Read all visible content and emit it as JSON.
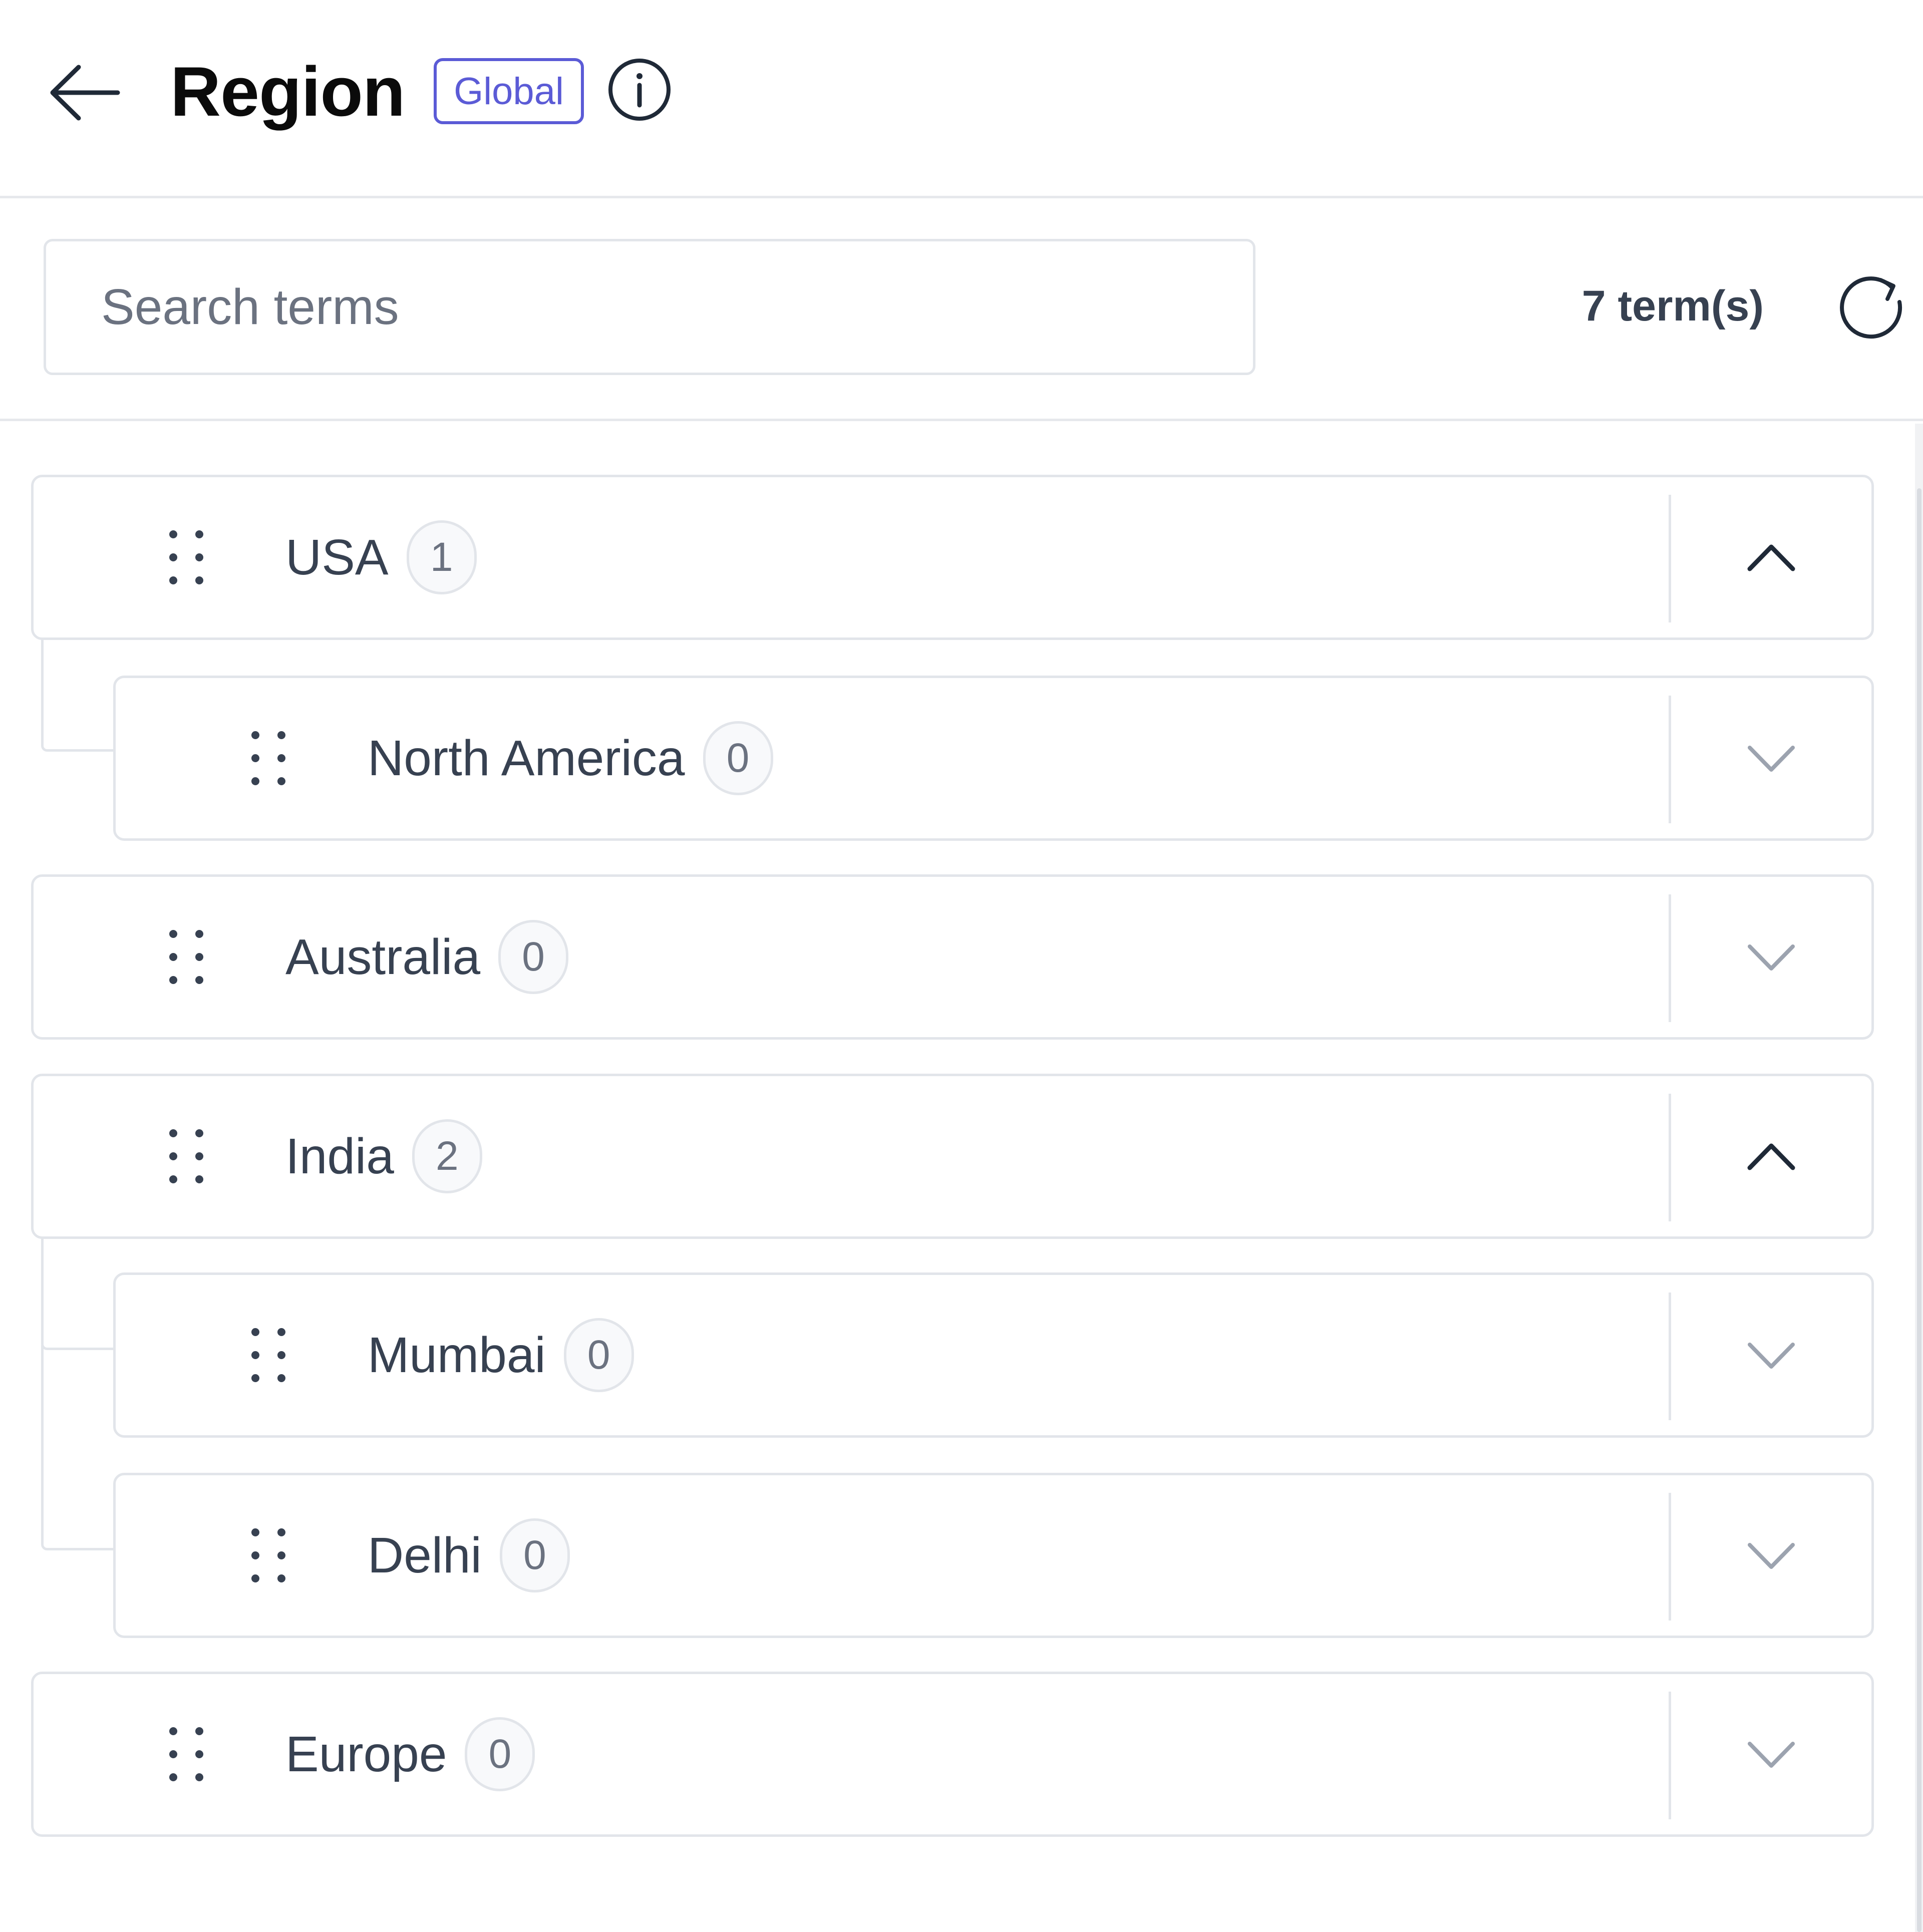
{
  "header": {
    "title": "Region",
    "scope_badge": "Global",
    "back_icon": "arrow-left-icon",
    "info_icon": "info-circle-icon"
  },
  "toolbar": {
    "search_placeholder": "Search terms",
    "search_value": "",
    "term_count": "7 term(s)",
    "refresh_icon": "refresh-icon"
  },
  "terms": [
    {
      "label": "USA",
      "count": "1",
      "level": 0,
      "expanded": true
    },
    {
      "label": "North America",
      "count": "0",
      "level": 1,
      "expanded": false
    },
    {
      "label": "Australia",
      "count": "0",
      "level": 0,
      "expanded": false
    },
    {
      "label": "India",
      "count": "2",
      "level": 0,
      "expanded": true
    },
    {
      "label": "Mumbai",
      "count": "0",
      "level": 1,
      "expanded": false
    },
    {
      "label": "Delhi",
      "count": "0",
      "level": 1,
      "expanded": false
    },
    {
      "label": "Europe",
      "count": "0",
      "level": 0,
      "expanded": false
    }
  ],
  "colors": {
    "accent": "#5b5bd6",
    "border": "#e2e5ea",
    "text": "#374151",
    "title": "#0b0b0b"
  }
}
